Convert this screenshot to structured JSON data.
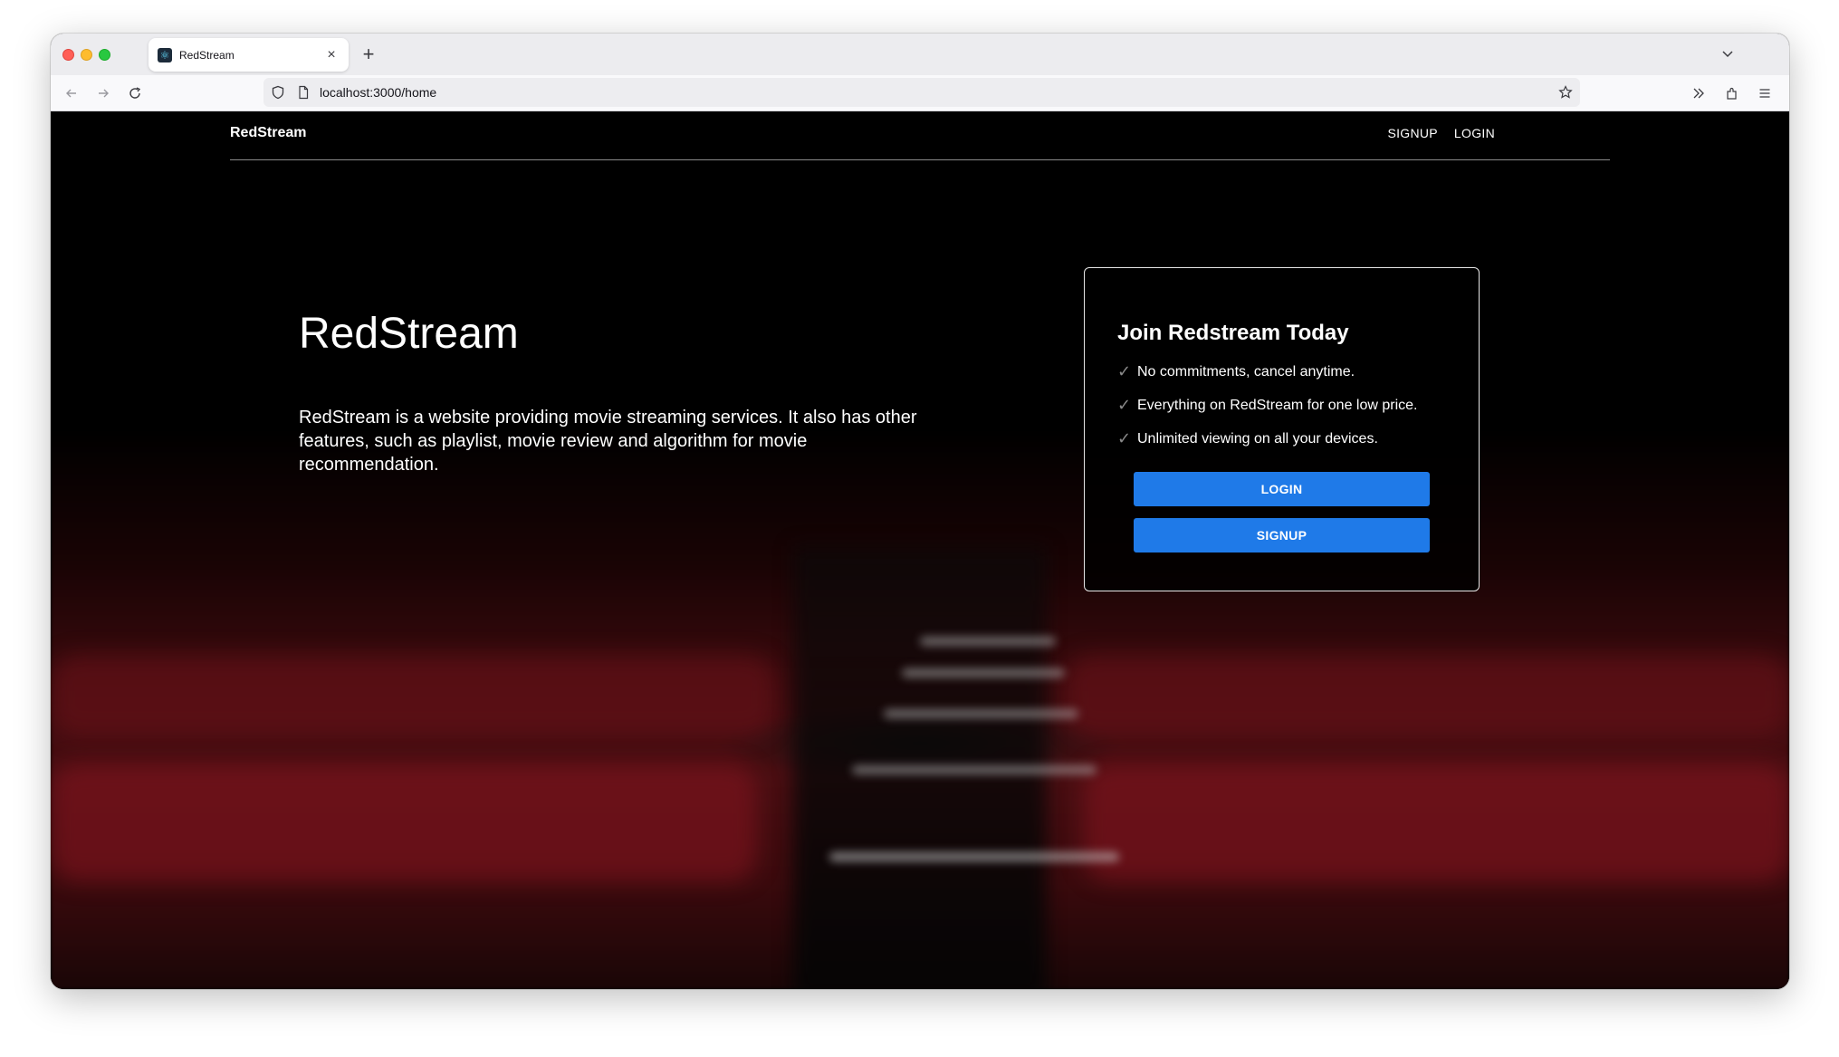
{
  "browser": {
    "tab_title": "RedStream",
    "url": "localhost:3000/home",
    "new_tab_label": "+",
    "close_tab_label": "×"
  },
  "nav": {
    "brand": "RedStream",
    "links": [
      "SIGNUP",
      "LOGIN"
    ]
  },
  "hero": {
    "title": "RedStream",
    "description": "RedStream is a website providing movie streaming services. It also has other features, such as playlist, movie review and algorithm for movie recommendation."
  },
  "card": {
    "title": "Join Redstream Today",
    "check_glyph": "✓",
    "features": [
      "No commitments, cancel anytime.",
      "Everything on RedStream for one low price.",
      "Unlimited viewing on all your devices."
    ],
    "login_label": "LOGIN",
    "signup_label": "SIGNUP"
  },
  "colors": {
    "button": "#1f7ae8",
    "background": "#000000",
    "seats": "#5a1016"
  },
  "icons": [
    "back-icon",
    "forward-icon",
    "reload-icon",
    "shield-icon",
    "page-icon",
    "star-icon",
    "overflow-icon",
    "extensions-icon",
    "menu-icon",
    "chevron-down-icon",
    "react-favicon-icon"
  ]
}
